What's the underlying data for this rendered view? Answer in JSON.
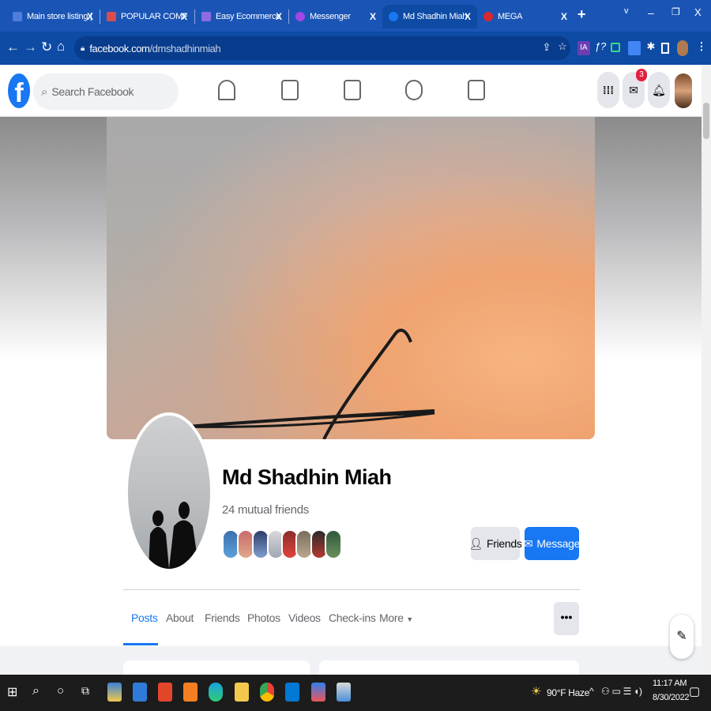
{
  "browser": {
    "tabs": [
      {
        "title": "Main store listing | PC",
        "color": "#4f7ddb"
      },
      {
        "title": "POPULAR COMPUTER",
        "color": "#d94d4d"
      },
      {
        "title": "Easy Ecommerce Adm",
        "color": "#8e6be0"
      },
      {
        "title": "Messenger",
        "color": "#a147e6"
      },
      {
        "title": "Md Shadhin Miah | Fa",
        "color": "#1877f2"
      },
      {
        "title": "MEGA",
        "color": "#d9272e"
      }
    ],
    "new_tab": "+",
    "url_host": "facebook.com",
    "url_path": "/dmshadhinmiah",
    "window_controls": [
      "v",
      "–",
      "❐",
      "X"
    ]
  },
  "facebook": {
    "search_placeholder": "Search Facebook",
    "messenger_badge": "3",
    "profile": {
      "name": "Md Shadhin Miah",
      "mutual_friends": "24 mutual friends",
      "friends_button": "Friends",
      "message_button": "Message"
    },
    "tabs": [
      "Posts",
      "About",
      "Friends",
      "Photos",
      "Videos",
      "Check-ins",
      "More"
    ],
    "more_caret": "▼",
    "dots": "•••"
  },
  "taskbar": {
    "weather": "90°F  Haze",
    "time": "11:17 AM",
    "date": "8/30/2022"
  },
  "colors": {
    "chrome_blue": "#1a55b6",
    "fb_blue": "#1877f2"
  }
}
